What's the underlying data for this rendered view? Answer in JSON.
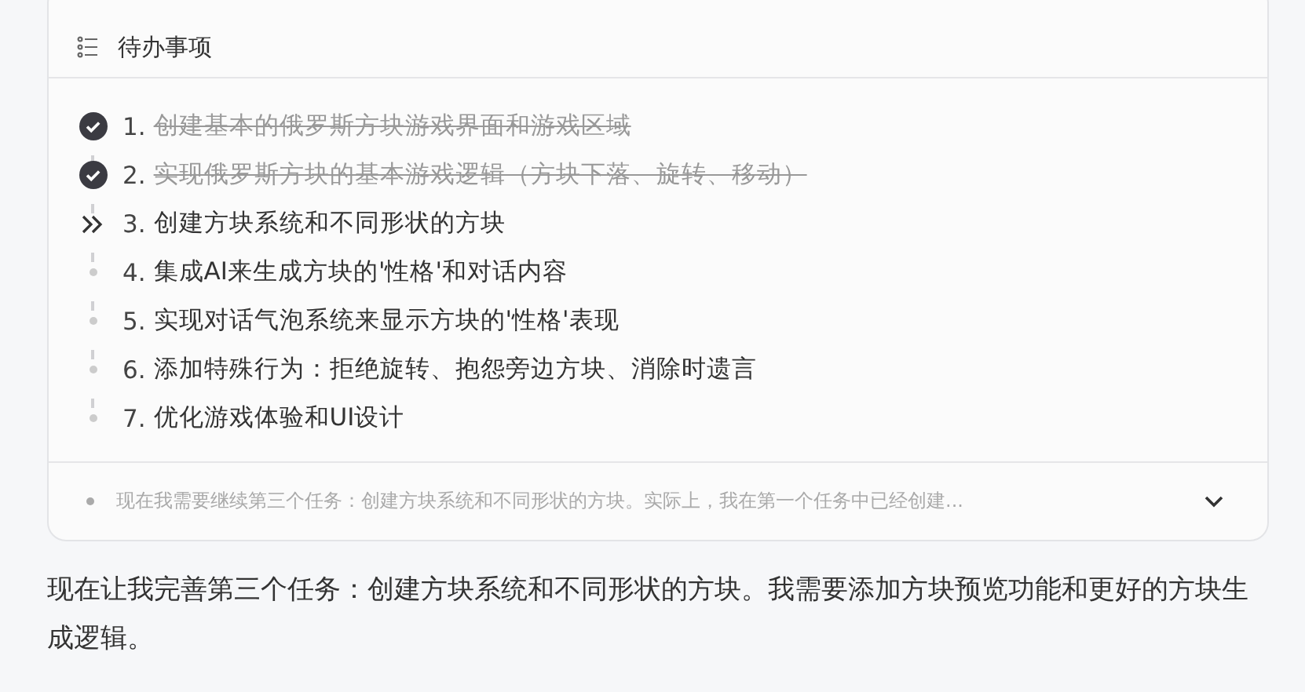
{
  "todo": {
    "title": "待办事项",
    "items": [
      {
        "number": "1.",
        "text": "创建基本的俄罗斯方块游戏界面和游戏区域",
        "kind": "done"
      },
      {
        "number": "2.",
        "text": "实现俄罗斯方块的基本游戏逻辑（方块下落、旋转、移动）",
        "kind": "done"
      },
      {
        "number": "3.",
        "text": "创建方块系统和不同形状的方块",
        "kind": "current"
      },
      {
        "number": "4.",
        "text": "集成AI来生成方块的'性格'和对话内容",
        "kind": "pending"
      },
      {
        "number": "5.",
        "text": "实现对话气泡系统来显示方块的'性格'表现",
        "kind": "pending"
      },
      {
        "number": "6.",
        "text": "添加特殊行为：拒绝旋转、抱怨旁边方块、消除时遗言",
        "kind": "pending"
      },
      {
        "number": "7.",
        "text": "优化游戏体验和UI设计",
        "kind": "pending"
      }
    ],
    "thought": {
      "text": "现在我需要继续第三个任务：创建方块系统和不同形状的方块。实际上，我在第一个任务中已经创建...",
      "expanded": false
    }
  },
  "message": "现在让我完善第三个任务：创建方块系统和不同形状的方块。我需要添加方块预览功能和更好的方块生成逻辑。"
}
